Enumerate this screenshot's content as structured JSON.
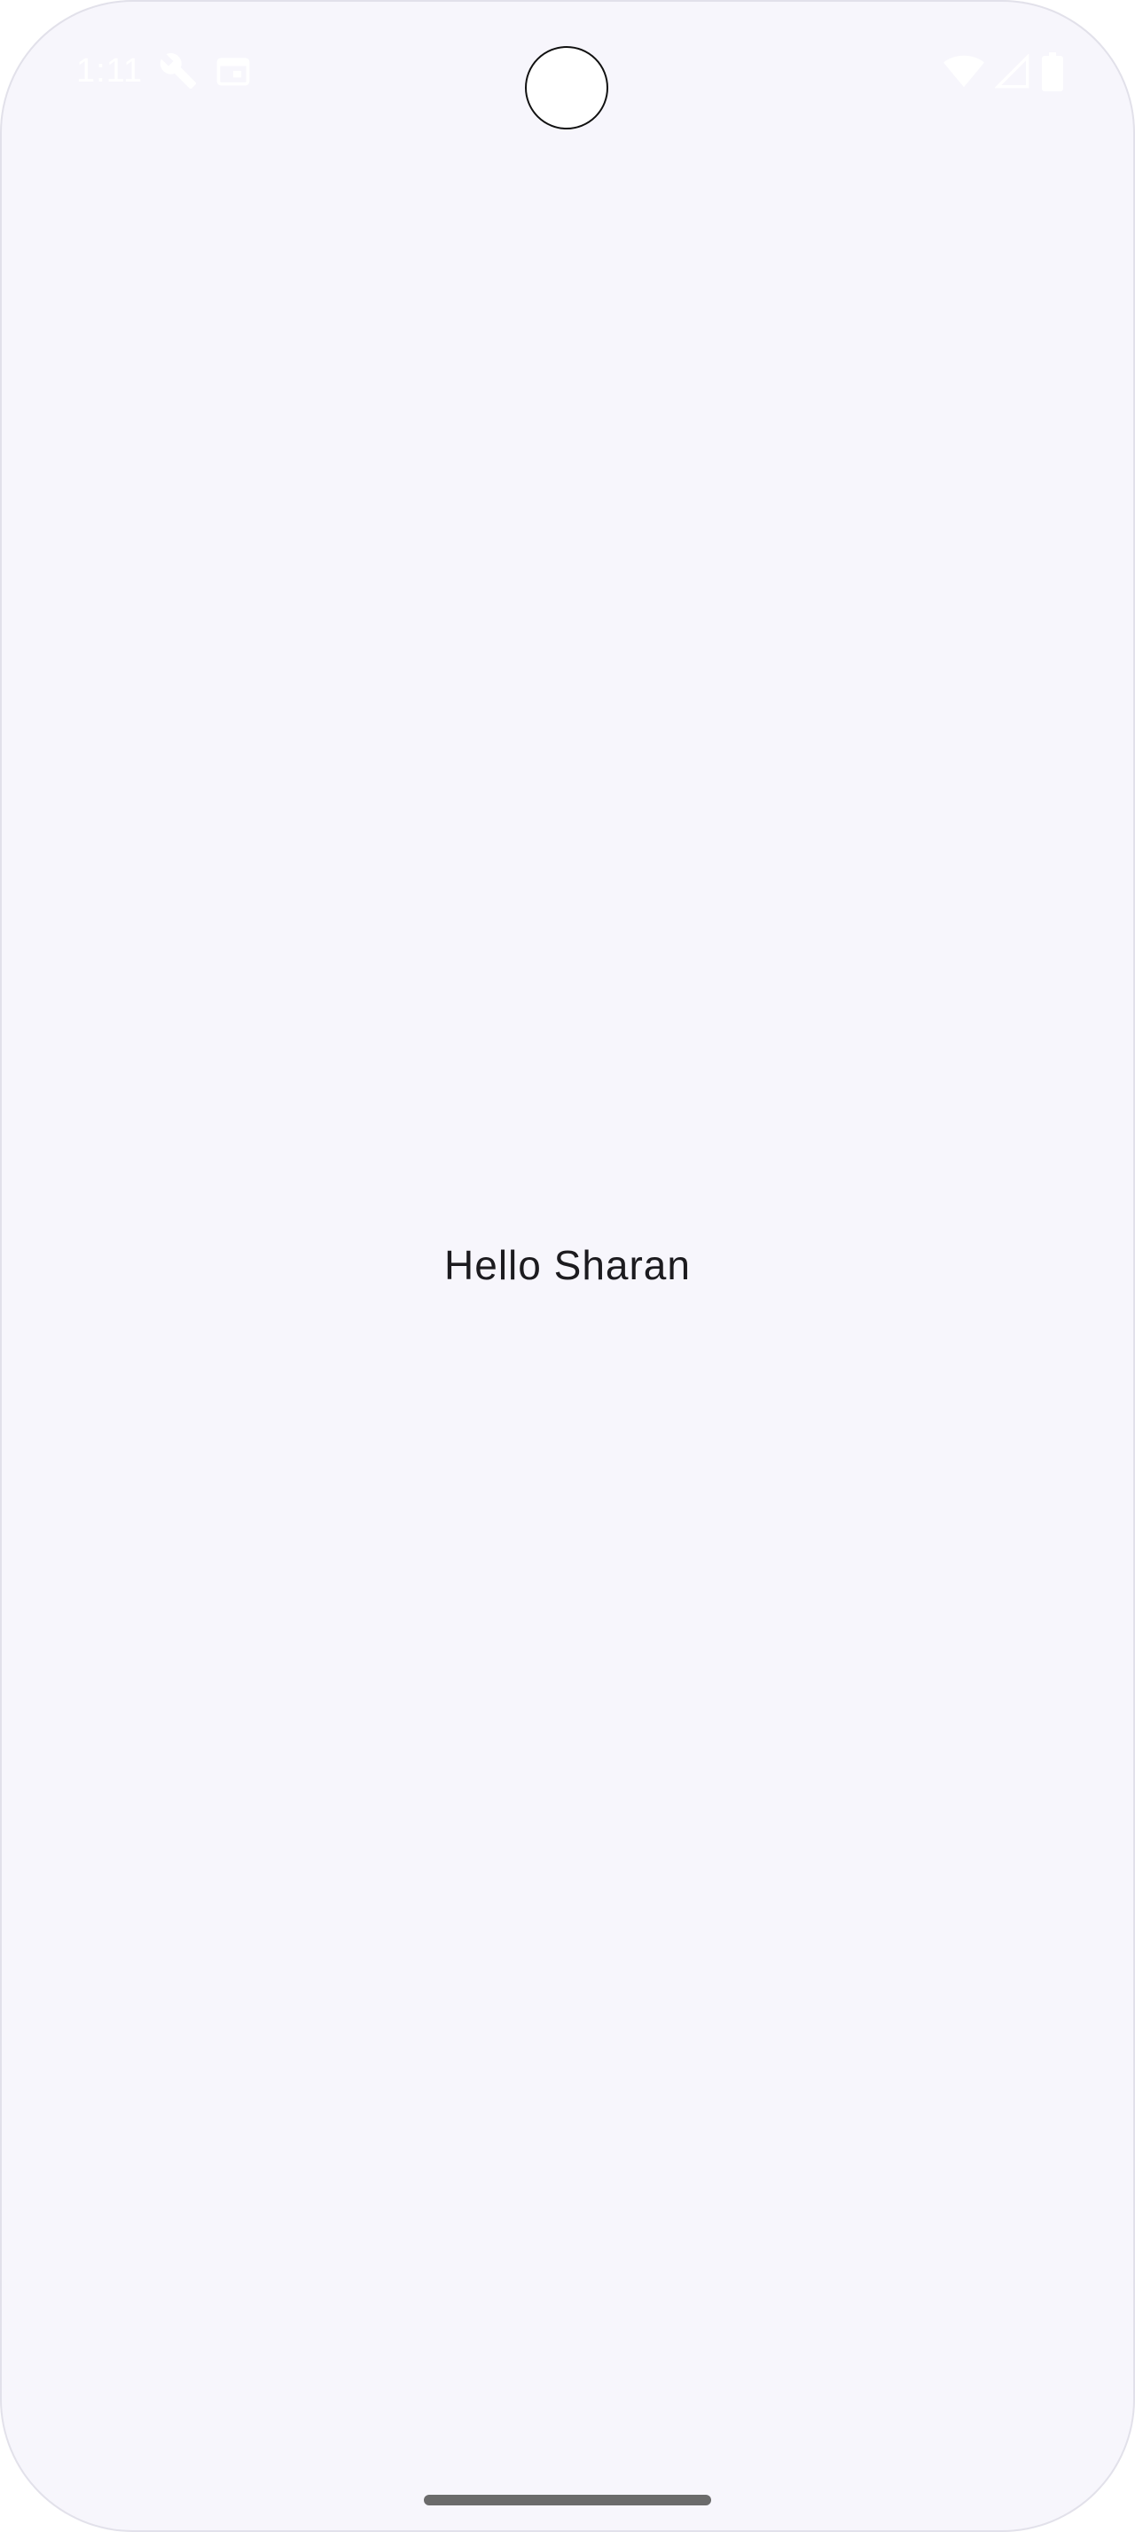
{
  "status_bar": {
    "time": "1:11",
    "left_icons": [
      "wrench-icon",
      "calendar-icon"
    ],
    "right_icons": [
      "wifi-icon",
      "cellular-signal-icon",
      "battery-icon"
    ]
  },
  "main": {
    "greeting": "Hello Sharan"
  },
  "colors": {
    "background": "#f7f6fc",
    "text": "#1c1b1f",
    "status_icons": "#ffffff",
    "nav_handle": "#6b6b6b"
  }
}
